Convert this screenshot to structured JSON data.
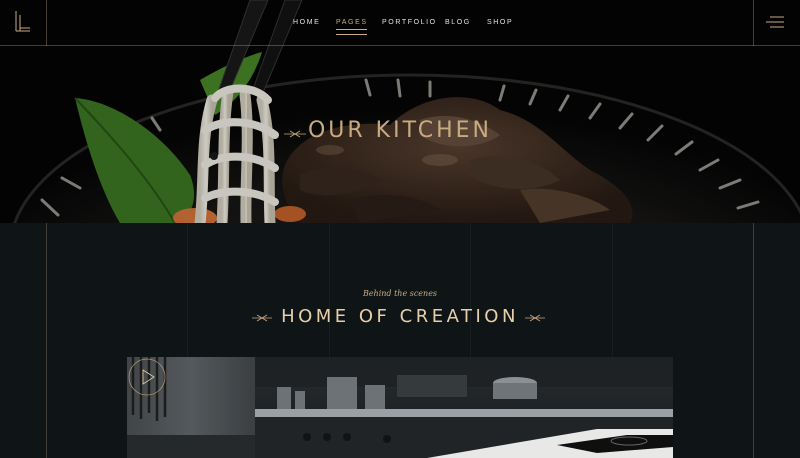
{
  "nav": {
    "items": [
      {
        "label": "HOME",
        "active": false
      },
      {
        "label": "PAGES",
        "active": true
      },
      {
        "label": "PORTFOLIO",
        "active": false
      },
      {
        "label": "BLOG",
        "active": false
      },
      {
        "label": "SHOP",
        "active": false
      }
    ]
  },
  "icons": {
    "logo": "logo-icon",
    "menu": "hamburger-menu-icon",
    "play": "play-icon",
    "ornament": "ornament-icon"
  },
  "hero": {
    "title": "OUR KITCHEN"
  },
  "section": {
    "subtitle": "Behind the scenes",
    "title": "HOME OF CREATION"
  },
  "colors": {
    "accent": "#c9ab81",
    "background": "#0f1517",
    "nav_text": "#e8e2d8"
  }
}
